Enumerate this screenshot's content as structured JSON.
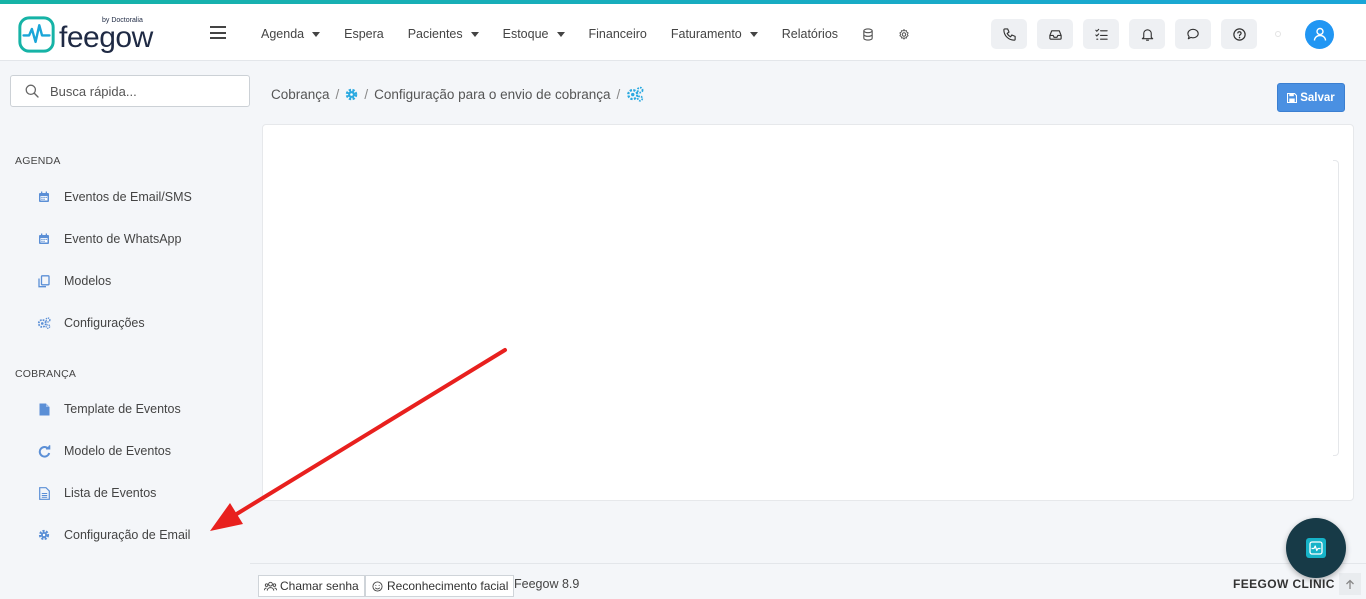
{
  "brand": {
    "logo_text": "feegow",
    "logo_by": "by Doctoralia"
  },
  "navbar": {
    "menu": [
      {
        "label": "Agenda",
        "dropdown": true
      },
      {
        "label": "Espera",
        "dropdown": false
      },
      {
        "label": "Pacientes",
        "dropdown": true
      },
      {
        "label": "Estoque",
        "dropdown": true
      },
      {
        "label": "Financeiro",
        "dropdown": false
      },
      {
        "label": "Faturamento",
        "dropdown": true
      },
      {
        "label": "Relatórios",
        "dropdown": false
      }
    ],
    "icons": [
      "database-icon",
      "gear-icon"
    ],
    "right_buttons": [
      "phone-icon",
      "inbox-icon",
      "checklist-icon",
      "bell-icon",
      "chat-icon",
      "help-icon"
    ]
  },
  "sidebar": {
    "search_placeholder": "Busca rápida...",
    "sections": [
      {
        "title": "AGENDA",
        "items": [
          {
            "label": "Eventos de Email/SMS",
            "icon": "calendar-icon"
          },
          {
            "label": "Evento de WhatsApp",
            "icon": "calendar-icon"
          },
          {
            "label": "Modelos",
            "icon": "copy-icon"
          },
          {
            "label": "Configurações",
            "icon": "gears-icon"
          }
        ]
      },
      {
        "title": "COBRANÇA",
        "items": [
          {
            "label": "Template de Eventos",
            "icon": "file-icon"
          },
          {
            "label": "Modelo de Eventos",
            "icon": "refresh-icon"
          },
          {
            "label": "Lista de Eventos",
            "icon": "file-list-icon"
          },
          {
            "label": "Configuração de Email",
            "icon": "gear-icon"
          }
        ]
      }
    ]
  },
  "breadcrumb": {
    "root": "Cobrança",
    "page": "Configuração para o envio de cobrança"
  },
  "actions": {
    "save_label": "Salvar"
  },
  "footer": {
    "call_label": "Chamar senha",
    "face_label": "Reconhecimento facial",
    "version": "Feegow 8.9",
    "brand": "FEEGOW CLINIC"
  },
  "colors": {
    "accent": "#4a90e2",
    "icon_blue": "#5b8fd6",
    "breadcrumb_icon": "#2aa9e0",
    "top_gradient_start": "#16b3a6",
    "top_gradient_end": "#1aa6d8",
    "avatar": "#2196f3",
    "arrow": "#e8201e"
  }
}
